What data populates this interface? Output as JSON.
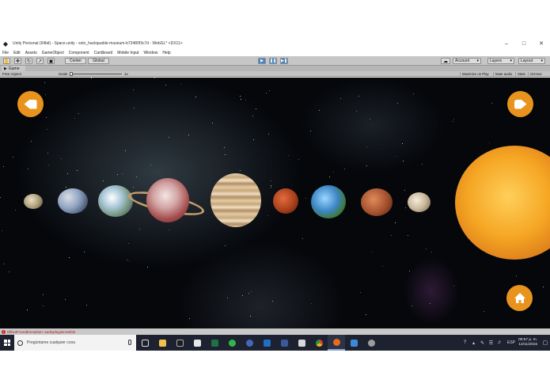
{
  "window": {
    "title": "Unity Personal (64bit) - Space.unity - solo_hackquable-museum-b73480f3c7d - WebGL* <DX11>",
    "controls": [
      "–",
      "□",
      "✕"
    ]
  },
  "menubar": [
    "File",
    "Edit",
    "Assets",
    "GameObject",
    "Component",
    "Cardboard",
    "Mobile Input",
    "Window",
    "Help"
  ],
  "toolbar": {
    "pivot_label": "Center",
    "space_label": "Global",
    "account_label": "Account",
    "layers_label": "Layers",
    "layout_label": "Layout",
    "play_active": true,
    "accent": "#4a86c5"
  },
  "game_panel": {
    "tab_label": "Game",
    "aspect_label": "Free Aspect",
    "scale_label": "Scale",
    "scale_value": "1x",
    "maximize_label": "Maximize on Play",
    "mute_label": "Mute audio",
    "stats_label": "Stats",
    "gizmos_label": "Gizmos"
  },
  "scene": {
    "button_color": "#e8931d",
    "planets": [
      "mercury",
      "venus",
      "earth",
      "saturn",
      "jupiter",
      "mars",
      "earth",
      "mars",
      "uranus",
      "sun"
    ]
  },
  "console": {
    "message": "DllNotFoundException: audioplugininvisible"
  },
  "taskbar": {
    "search_placeholder": "Pregúntame cualquier cosa",
    "language": "ESP",
    "time": "08:57 p. m.",
    "date": "12/11/2016"
  }
}
